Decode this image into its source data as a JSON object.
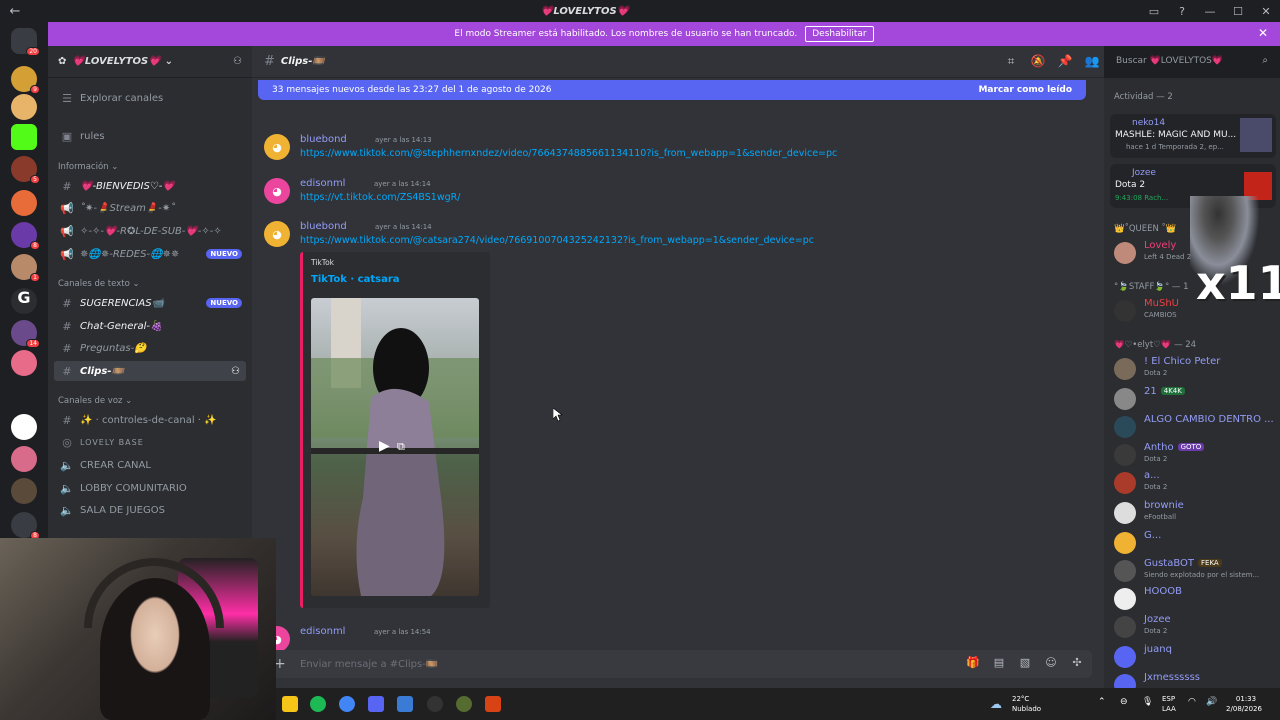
{
  "window": {
    "title": "💗LOVELYTOS💗"
  },
  "banner": {
    "text": "El modo Streamer está habilitado. Los nombres de usuario se han truncado.",
    "button": "Deshabilitar"
  },
  "server": {
    "name": "💗LOVELYTOS💗"
  },
  "sidebar": {
    "explore": "Explorar canales",
    "rules": "rules",
    "cat_info": "Información",
    "info_channels": [
      "💗-BIENVEDIS♡-💗",
      "˚✷-💄Stream💄-✷˚",
      "✧-✧-💗-R✪L-DE-SUB-💗-✧-✧",
      "✵🌐✵-REDES-🌐✵✵"
    ],
    "new_badge": "NUEVO",
    "cat_text": "Canales de texto",
    "text_channels": [
      "SUGERENCIAS📹",
      "Chat-General-🍇",
      "Preguntas-🤔",
      "Clips-🎞️"
    ],
    "cat_voice": "Canales de voz",
    "voice_channels": [
      "✨ · controles-de-canal · ✨",
      "LOVELY BASE",
      "CREAR CANAL",
      "LOBBY COMUNITARIO",
      "SALA DE JUEGOS"
    ]
  },
  "channel": {
    "name": "Clips-🎞️"
  },
  "new_messages": {
    "text": "33 mensajes nuevos desde las 23:27 del 1 de agosto de 2026",
    "mark": "Marcar como leído"
  },
  "messages": [
    {
      "author": "bluebond",
      "time": "ayer a las 14:13",
      "text": "https://www.tiktok.com/@stephhernxndez/video/7664374885661134110?is_from_webapp=1&sender_device=pc"
    },
    {
      "author": "edisonml",
      "time": "ayer a las 14:14",
      "text": "https://vt.tiktok.com/ZS4BS1wgR/"
    },
    {
      "author": "bluebond",
      "time": "ayer a las 14:14",
      "text": "https://www.tiktok.com/@catsara274/video/7669100704325242132?is_from_webapp=1&sender_device=pc"
    },
    {
      "author": "edisonml",
      "time": "ayer a las 14:54",
      "text": ""
    }
  ],
  "embed": {
    "provider": "TikTok",
    "title": "TikTok · catsara"
  },
  "composer": {
    "placeholder": "Enviar mensaje a #Clips-🎞️"
  },
  "search": {
    "placeholder": "Buscar 💗LOVELYTOS💗"
  },
  "members": {
    "activity_header": "Actividad — 2",
    "activity": [
      {
        "name": "neko14",
        "title": "MASHLE: MAGIC AND MU...",
        "sub": "hace 1 d   Temporada 2, ep..."
      },
      {
        "name": "Jozee",
        "title": "Dota 2",
        "sub": "9:43:08   Rach..."
      }
    ],
    "queen_header": "👑˚QUEEN ˚👑",
    "queen": [
      {
        "name": "Lovely",
        "sub": "Left 4 Dead 2"
      }
    ],
    "staff_header": "°🍃STAFF🍃° — 1",
    "staff": [
      {
        "name": "MuShU",
        "sub": "CAMBIOS"
      }
    ],
    "lovely_header": "💗♡•elyt♡💗 — 24",
    "lovely": [
      {
        "name": "! El Chico Peter",
        "sub": "Dota 2",
        "tag": ""
      },
      {
        "name": "21",
        "sub": "",
        "tag": "4K4K"
      },
      {
        "name": "ALGO CAMBIO DENTRO ...",
        "sub": "",
        "tag": ""
      },
      {
        "name": "Antho",
        "sub": "Dota 2",
        "tag": "GOTO"
      },
      {
        "name": "a...",
        "sub": "Dota 2",
        "tag": ""
      },
      {
        "name": "brownie",
        "sub": "eFootball",
        "tag": ""
      },
      {
        "name": "G...",
        "sub": "",
        "tag": ""
      },
      {
        "name": "GustaBOT",
        "sub": "Siendo explotado por el sistem...",
        "tag": "FEKA"
      },
      {
        "name": "HOOOB",
        "sub": "",
        "tag": ""
      },
      {
        "name": "Jozee",
        "sub": "Dota 2",
        "tag": ""
      },
      {
        "name": "juanq",
        "sub": "",
        "tag": ""
      },
      {
        "name": "Jxmessssss",
        "sub": "",
        "tag": ""
      }
    ]
  },
  "overlay": {
    "x11": "x11"
  },
  "rail_badges": [
    "20",
    "9",
    "5",
    "8",
    "1",
    "14",
    "8"
  ],
  "taskbar": {
    "weather_temp": "22°C",
    "weather_desc": "Nublado",
    "lang_1": "ESP",
    "lang_2": "LAA",
    "time": "01:33",
    "date": "2/08/2026"
  },
  "colors": {
    "accent": "#5865f2",
    "banner": "#a348db",
    "link": "#00a8fc"
  }
}
